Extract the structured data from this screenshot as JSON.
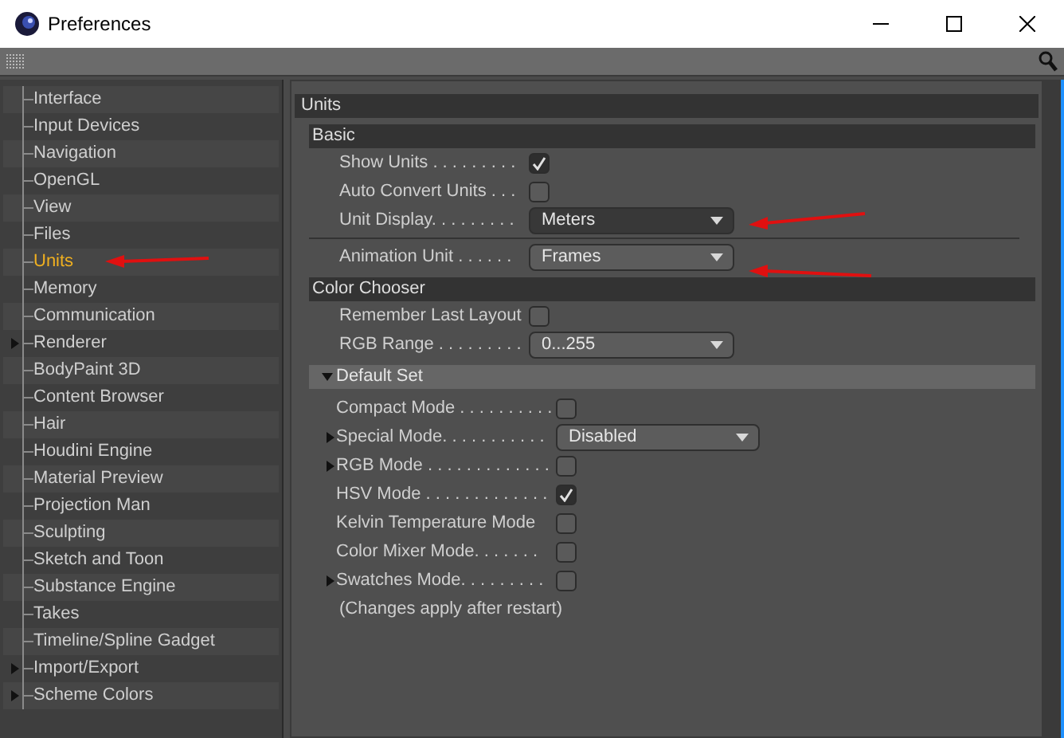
{
  "window": {
    "title": "Preferences"
  },
  "sidebar": {
    "items": [
      {
        "label": "Interface",
        "selected": false,
        "expandable": false
      },
      {
        "label": "Input Devices",
        "selected": false,
        "expandable": false
      },
      {
        "label": "Navigation",
        "selected": false,
        "expandable": false
      },
      {
        "label": "OpenGL",
        "selected": false,
        "expandable": false
      },
      {
        "label": "View",
        "selected": false,
        "expandable": false
      },
      {
        "label": "Files",
        "selected": false,
        "expandable": false
      },
      {
        "label": "Units",
        "selected": true,
        "expandable": false
      },
      {
        "label": "Memory",
        "selected": false,
        "expandable": false
      },
      {
        "label": "Communication",
        "selected": false,
        "expandable": false
      },
      {
        "label": "Renderer",
        "selected": false,
        "expandable": true
      },
      {
        "label": "BodyPaint 3D",
        "selected": false,
        "expandable": false
      },
      {
        "label": "Content Browser",
        "selected": false,
        "expandable": false
      },
      {
        "label": "Hair",
        "selected": false,
        "expandable": false
      },
      {
        "label": "Houdini Engine",
        "selected": false,
        "expandable": false
      },
      {
        "label": "Material Preview",
        "selected": false,
        "expandable": false
      },
      {
        "label": "Projection Man",
        "selected": false,
        "expandable": false
      },
      {
        "label": "Sculpting",
        "selected": false,
        "expandable": false
      },
      {
        "label": "Sketch and Toon",
        "selected": false,
        "expandable": false
      },
      {
        "label": "Substance Engine",
        "selected": false,
        "expandable": false
      },
      {
        "label": "Takes",
        "selected": false,
        "expandable": false
      },
      {
        "label": "Timeline/Spline Gadget",
        "selected": false,
        "expandable": false
      },
      {
        "label": "Import/Export",
        "selected": false,
        "expandable": true
      },
      {
        "label": "Scheme Colors",
        "selected": false,
        "expandable": true
      }
    ]
  },
  "panel": {
    "title": "Units",
    "rows": [
      {
        "kind": "section",
        "label": "Basic"
      },
      {
        "kind": "checkbox",
        "label": "Show Units . . . . . . . . .",
        "checked": true
      },
      {
        "kind": "checkbox",
        "label": "Auto Convert Units . . .",
        "checked": false
      },
      {
        "kind": "dropdown",
        "label": "Unit Display. . . . . . . . .",
        "value": "Meters",
        "focused": true
      },
      {
        "kind": "separator"
      },
      {
        "kind": "dropdown",
        "label": "Animation Unit . . . . . .",
        "value": "Frames",
        "focused": false
      },
      {
        "kind": "section",
        "label": "Color Chooser"
      },
      {
        "kind": "checkbox",
        "label": "Remember Last Layout",
        "checked": false
      },
      {
        "kind": "dropdown",
        "label": "RGB Range . . . . . . . . .",
        "value": "0...255",
        "focused": false
      },
      {
        "kind": "group",
        "label": "Default Set",
        "expanded": true,
        "children": [
          {
            "kind": "checkbox",
            "label": "Compact Mode . . . . . . . . . .",
            "checked": false,
            "expandable": false
          },
          {
            "kind": "dropdown",
            "label": "Special Mode. . . . . . . . . . .",
            "value": "Disabled",
            "focused": false,
            "expandable": true
          },
          {
            "kind": "checkbox",
            "label": "RGB Mode . . . . . . . . . . . . .",
            "checked": false,
            "expandable": true
          },
          {
            "kind": "checkbox",
            "label": "HSV Mode . . . . . . . . . . . . .",
            "checked": true,
            "expandable": false
          },
          {
            "kind": "checkbox",
            "label": "Kelvin Temperature Mode",
            "checked": false,
            "expandable": false
          },
          {
            "kind": "checkbox",
            "label": "Color Mixer Mode. . . . . . .",
            "checked": false,
            "expandable": false
          },
          {
            "kind": "checkbox",
            "label": "Swatches Mode. . . . . . . . .",
            "checked": false,
            "expandable": true
          }
        ]
      },
      {
        "kind": "note",
        "label": "(Changes apply after restart)"
      }
    ]
  }
}
